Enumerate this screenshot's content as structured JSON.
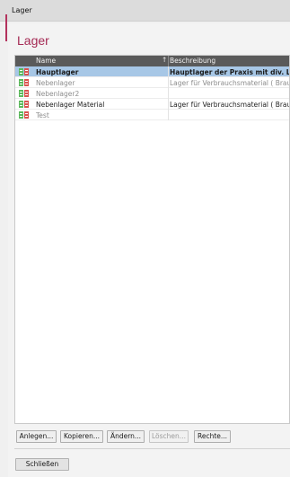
{
  "window": {
    "title": "Lager"
  },
  "header": {
    "title": "Lager"
  },
  "grid": {
    "columns": [
      {
        "label": "Name"
      },
      {
        "label": "Beschreibung"
      }
    ],
    "rows": [
      {
        "name": "Hauptlager",
        "desc": "Hauptlager der Praxis mit div. La",
        "state": "selected"
      },
      {
        "name": "Nebenlager",
        "desc": "Lager für Verbrauchsmaterial ( Braun",
        "state": "dim"
      },
      {
        "name": "Nebenlager2",
        "desc": "",
        "state": "dim"
      },
      {
        "name": "Nebenlager Material",
        "desc": "Lager für Verbrauchsmaterial ( Braun",
        "state": "normal"
      },
      {
        "name": "Test",
        "desc": "",
        "state": "dim"
      }
    ]
  },
  "buttons": {
    "create": "Anlegen...",
    "copy": "Kopieren...",
    "edit": "Ändern...",
    "delete": "Löschen...",
    "rights": "Rechte...",
    "close": "Schließen"
  },
  "icons": {
    "row_icon": "warehouse-shelf-icon",
    "sort": "sort-asc-icon"
  },
  "colors": {
    "accent": "#a52a54",
    "header_bg": "#5a5a5a",
    "selected": "#a7c7e6"
  }
}
